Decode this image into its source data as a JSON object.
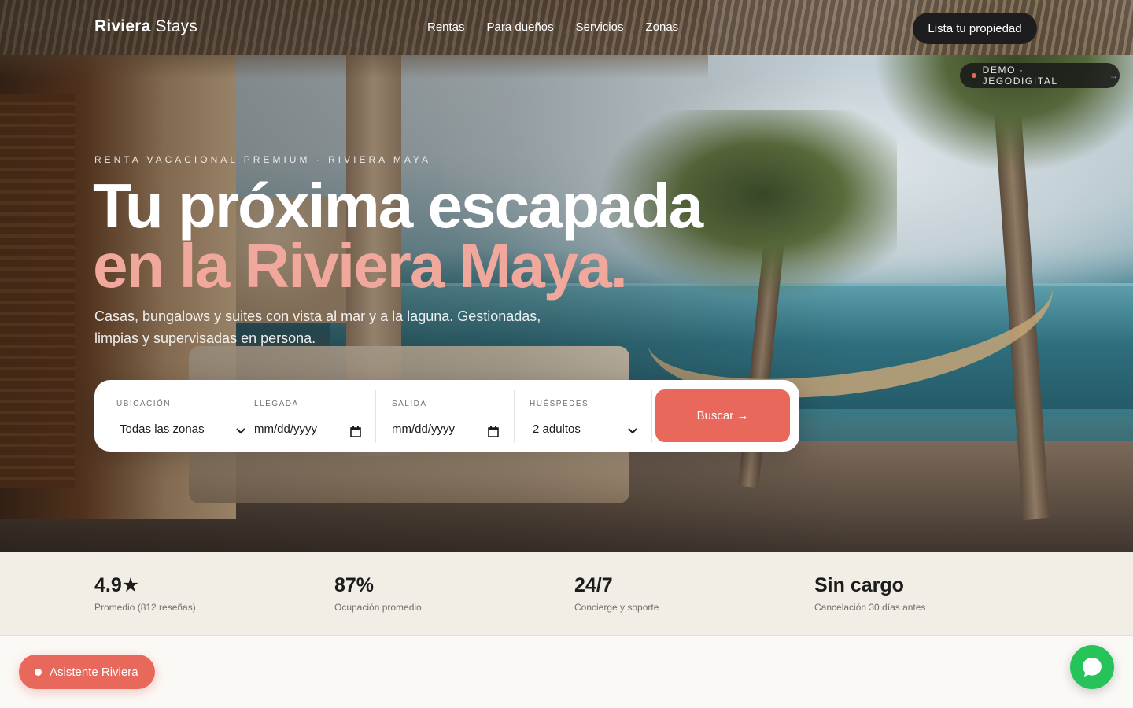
{
  "brand": {
    "name_bold": "Riviera",
    "name_light": "Stays"
  },
  "nav": {
    "items": [
      "Rentas",
      "Para dueños",
      "Servicios",
      "Zonas"
    ],
    "cta": "Lista tu propiedad"
  },
  "demo": {
    "label": "DEMO · JEGODIGITAL",
    "arrow": "→"
  },
  "hero": {
    "kicker": "RENTA VACACIONAL PREMIUM · RIVIERA MAYA",
    "title_line1": "Tu próxima escapada",
    "title_line2": "en la Riviera Maya.",
    "subtitle": "Casas, bungalows y suites con vista al mar y a la laguna. Gestionadas, limpias y supervisadas en persona."
  },
  "search": {
    "location": {
      "label": "UBICACIÓN",
      "value": "Todas las zonas"
    },
    "checkin": {
      "label": "LLEGADA",
      "placeholder": "mm/dd/yyyy"
    },
    "checkout": {
      "label": "SALIDA",
      "placeholder": "mm/dd/yyyy"
    },
    "guests": {
      "label": "HUÉSPEDES",
      "value": "2 adultos"
    },
    "button": "Buscar →"
  },
  "stats": [
    {
      "value": "4.9★",
      "caption": "Promedio (812 reseñas)"
    },
    {
      "value": "87%",
      "caption": "Ocupación promedio"
    },
    {
      "value": "24/7",
      "caption": "Concierge y soporte"
    },
    {
      "value": "Sin cargo",
      "caption": "Cancelación 30 días antes"
    }
  ],
  "assistant": {
    "label": "Asistente Riviera"
  },
  "icons": {
    "chat": "whatsapp-chat-icon",
    "calendar": "calendar-icon",
    "chevron": "chevron-down-icon"
  },
  "colors": {
    "accent": "#e8685b",
    "accent_text": "#f0a79c",
    "dark": "#1d1d1f",
    "whatsapp": "#25c35a",
    "stats_bg": "#f2ede5"
  }
}
